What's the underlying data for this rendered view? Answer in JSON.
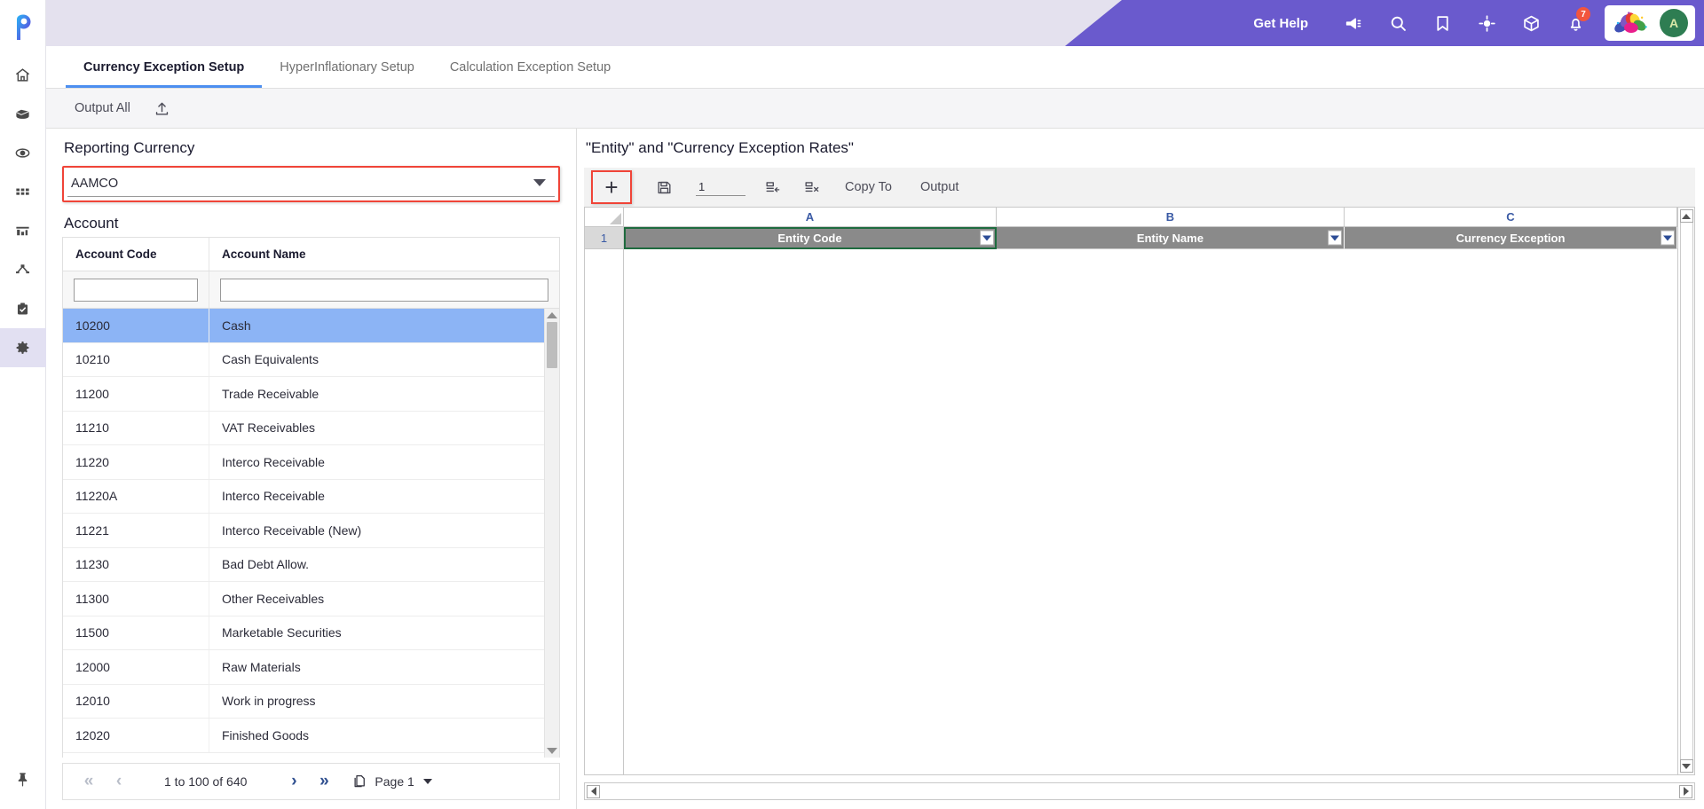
{
  "header": {
    "get_help": "Get Help",
    "notification_count": "7",
    "avatar_initial": "A",
    "icons": [
      "megaphone-icon",
      "search-icon",
      "bookmark-icon",
      "target-icon",
      "cube-icon",
      "bell-icon"
    ],
    "purple": "#6a5acd",
    "badge_color": "#f2553d"
  },
  "rail": {
    "items": [
      {
        "name": "home-icon",
        "active": false
      },
      {
        "name": "package-icon",
        "active": false
      },
      {
        "name": "eye-icon",
        "active": false
      },
      {
        "name": "grid-icon",
        "active": false
      },
      {
        "name": "chart-icon",
        "active": false
      },
      {
        "name": "hierarchy-icon",
        "active": false
      },
      {
        "name": "clipboard-check-icon",
        "active": false
      },
      {
        "name": "gear-icon",
        "active": true
      }
    ],
    "pin": "pin-icon"
  },
  "tabs": [
    {
      "label": "Currency Exception Setup",
      "active": true
    },
    {
      "label": "HyperInflationary Setup",
      "active": false
    },
    {
      "label": "Calculation Exception Setup",
      "active": false
    }
  ],
  "subtoolbar": {
    "output_all": "Output All",
    "upload_icon": "upload-icon"
  },
  "left_panel": {
    "reporting_currency_label": "Reporting Currency",
    "reporting_currency_value": "AAMCO",
    "reporting_currency_options": [
      "AAMCO"
    ],
    "account_label": "Account",
    "columns": [
      "Account Code",
      "Account Name"
    ],
    "filter_code": "",
    "filter_name": "",
    "filter_placeholder": "",
    "rows": [
      {
        "code": "10200",
        "name": "Cash",
        "selected": true
      },
      {
        "code": "10210",
        "name": "Cash Equivalents",
        "selected": false
      },
      {
        "code": "11200",
        "name": "Trade Receivable",
        "selected": false
      },
      {
        "code": "11210",
        "name": "VAT Receivables",
        "selected": false
      },
      {
        "code": "11220",
        "name": "Interco Receivable",
        "selected": false
      },
      {
        "code": "11220A",
        "name": "Interco Receivable",
        "selected": false
      },
      {
        "code": "11221",
        "name": "Interco Receivable (New)",
        "selected": false
      },
      {
        "code": "11230",
        "name": "Bad Debt Allow.",
        "selected": false
      },
      {
        "code": "11300",
        "name": "Other Receivables",
        "selected": false
      },
      {
        "code": "11500",
        "name": "Marketable Securities",
        "selected": false
      },
      {
        "code": "12000",
        "name": "Raw Materials",
        "selected": false
      },
      {
        "code": "12010",
        "name": "Work in progress",
        "selected": false
      },
      {
        "code": "12020",
        "name": "Finished Goods",
        "selected": false
      }
    ],
    "pagination": {
      "first": "«",
      "prev": "‹",
      "status": "1 to 100 of 640",
      "next": "›",
      "last": "»",
      "page_label": "Page 1",
      "page_icon": "copy-page-icon"
    }
  },
  "right_panel": {
    "title": "\"Entity\" and \"Currency Exception Rates\"",
    "toolbar": {
      "add_label": "+",
      "save_icon": "save-icon",
      "row_count": "1",
      "insert_icon": "insert-row-icon",
      "delete_icon": "delete-row-icon",
      "copy_to": "Copy To",
      "output": "Output"
    },
    "sheet": {
      "column_letters": [
        "A",
        "B",
        "C"
      ],
      "row_number": "1",
      "fields": [
        {
          "label": "Entity Code",
          "selected": true
        },
        {
          "label": "Entity Name",
          "selected": false
        },
        {
          "label": "Currency Exception",
          "selected": false
        }
      ],
      "data_rows": []
    }
  }
}
